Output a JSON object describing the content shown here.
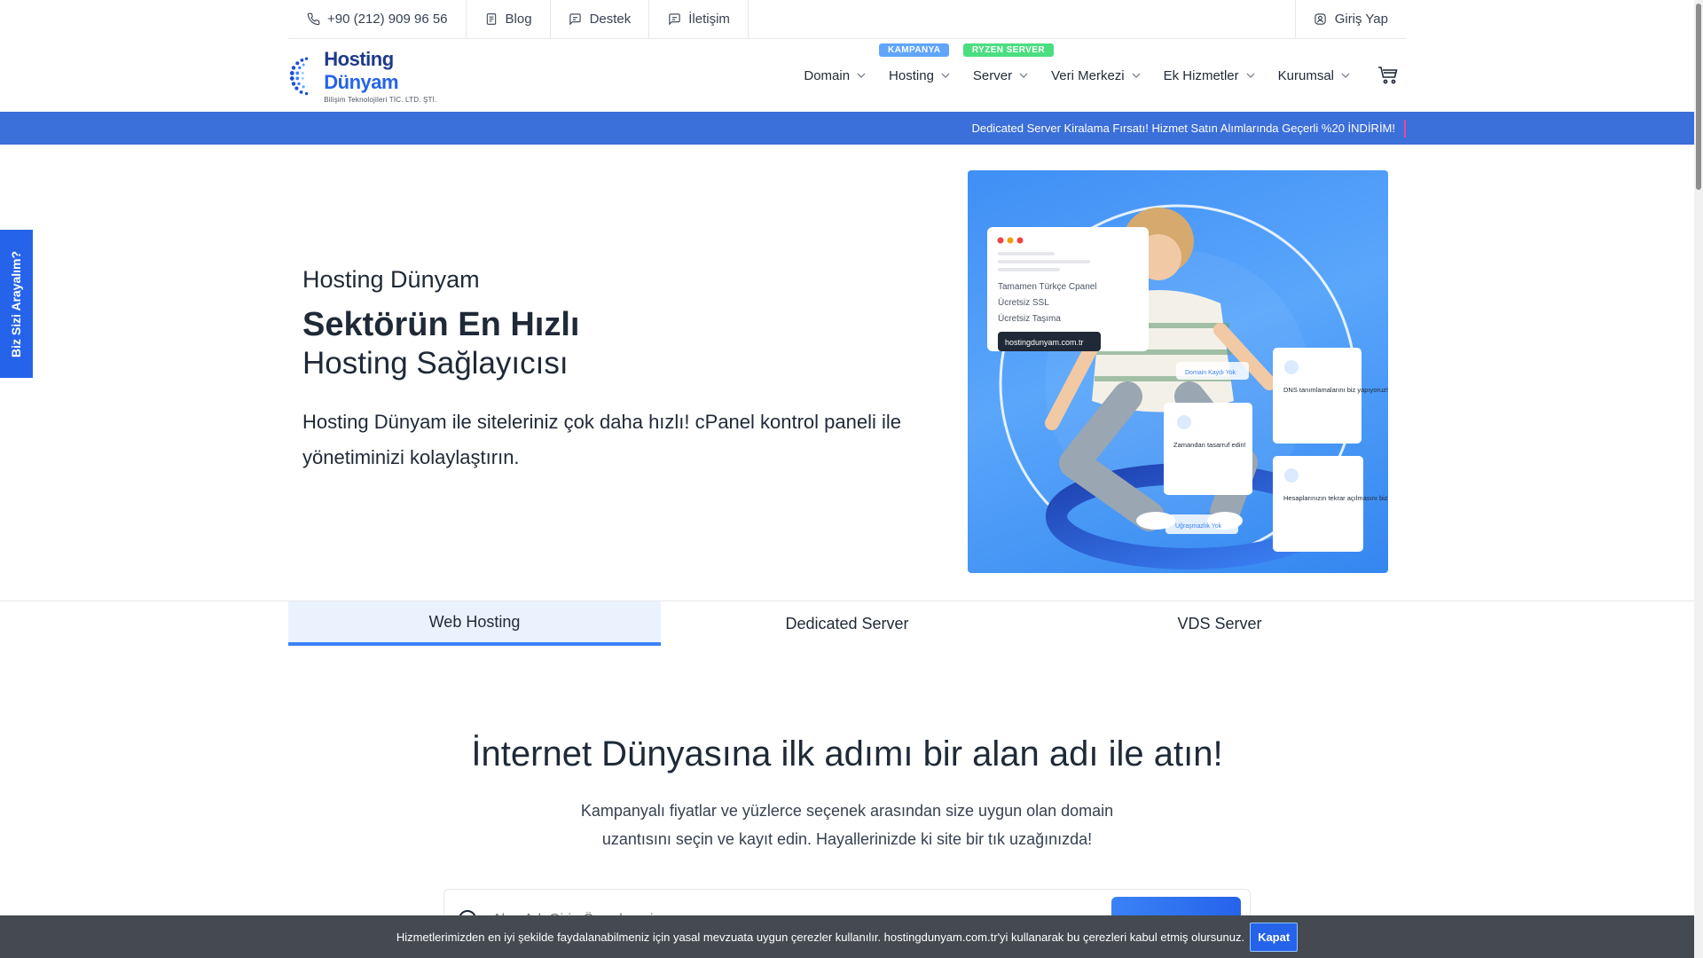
{
  "topbar": {
    "phone": "+90 (212) 909 96 56",
    "blog": "Blog",
    "support": "Destek",
    "contact": "İletişim",
    "login": "Giriş Yap"
  },
  "logo": {
    "name_part1": "Hosting ",
    "name_part2": "Dünyam",
    "subtitle": "Bilişim Teknolojileri TİC. LTD. ŞTİ."
  },
  "nav": {
    "items": [
      {
        "label": "Domain",
        "badge": ""
      },
      {
        "label": "Hosting",
        "badge": "KAMPANYA"
      },
      {
        "label": "Server",
        "badge": "RYZEN SERVER"
      },
      {
        "label": "Veri Merkezi",
        "badge": ""
      },
      {
        "label": "Ek Hizmetler",
        "badge": ""
      },
      {
        "label": "Kurumsal",
        "badge": ""
      }
    ]
  },
  "announcement": "Dedicated Server Kiralama Fırsatı! Hizmet Satın Alımlarında Geçerli %20 İNDİRİM!",
  "side_tab": "Biz Sizi Arayalım?",
  "hero": {
    "kicker": "Hosting Dünyam",
    "title": "Sektörün En Hızlı",
    "title2": "Hosting Sağlayıcısı",
    "desc": "Hosting Dünyam ile siteleriniz çok daha hızlı! cPanel kontrol paneli ile yönetiminizi kolaylaştırın."
  },
  "hero_image": {
    "card1_lines": [
      "Tamamen Türkçe Cpanel",
      "Ücretsiz SSL",
      "Ücretsiz Taşıma"
    ],
    "card1_url": "hostingdunyam.com.tr",
    "pill1": "Domain Kaydı Yok",
    "card_dns": "DNS tanımlamalarını biz yapıyoruz!",
    "card_time": "Zamandan tasarruf edin!",
    "card_acc": "Hesaplarınızın tekrar açılmasını biz yapıyoruz!",
    "pill2": "Uğraşmazlık Yok"
  },
  "tabs": [
    {
      "label": "Web Hosting",
      "active": true
    },
    {
      "label": "Dedicated Server",
      "active": false
    },
    {
      "label": "VDS Server",
      "active": false
    }
  ],
  "domain_section": {
    "title": "İnternet Dünyasına ilk adımı bir alan adı ile atın!",
    "desc_line1": "Kampanyalı fiyatlar ve yüzlerce seçenek arasından size uygun olan domain",
    "desc_line2": "uzantısını seçin ve kayıt edin. Hayallerinizde ki site bir tık uzağınızda!",
    "search_placeholder": "Alan Adı Girin Örn: domain.com"
  },
  "cookie": {
    "text": "Hizmetlerimizden en iyi şekilde faydalanabilmeniz için yasal mevzuata uygun çerezler kullanılır. hostingdunyam.com.tr'yi kullanarak bu çerezleri kabul etmiş olursunuz.",
    "button": "Kapat"
  },
  "colors": {
    "primary": "#2563eb",
    "announce_bg": "#3b6fd9",
    "badge_campaign": "#60a5fa",
    "badge_ryzen": "#4ade80",
    "cookie_bg": "#444a50"
  }
}
